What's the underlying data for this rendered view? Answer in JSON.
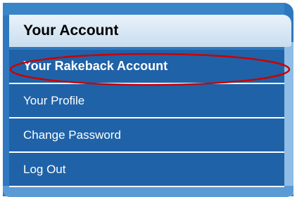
{
  "menu": {
    "header": "Your Account",
    "items": [
      {
        "label": "Your Rakeback Account",
        "active": true
      },
      {
        "label": "Your Profile",
        "active": false
      },
      {
        "label": "Change Password",
        "active": false
      },
      {
        "label": "Log Out",
        "active": false
      }
    ]
  },
  "colors": {
    "menu_background": "#1f62a8",
    "header_background": "#d6e6f4",
    "highlight_annotation": "#cc0000"
  }
}
